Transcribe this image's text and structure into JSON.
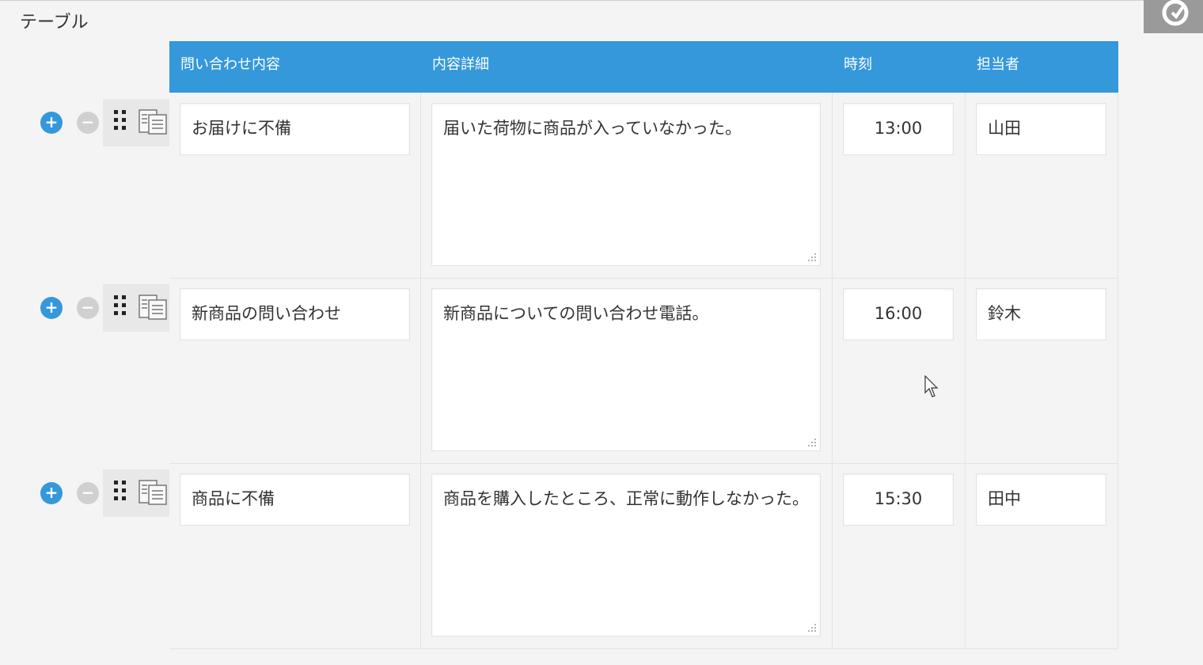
{
  "section": {
    "title": "テーブル"
  },
  "table": {
    "headers": [
      "問い合わせ内容",
      "内容詳細",
      "時刻",
      "担当者"
    ],
    "rows": [
      {
        "inquiry": "お届けに不備",
        "detail": "届いた荷物に商品が入っていなかった。",
        "time": "13:00",
        "owner": "山田"
      },
      {
        "inquiry": "新商品の問い合わせ",
        "detail": "新商品についての問い合わせ電話。",
        "time": "16:00",
        "owner": "鈴木"
      },
      {
        "inquiry": "商品に不備",
        "detail": "商品を購入したところ、正常に動作しなかった。",
        "time": "15:30",
        "owner": "田中"
      }
    ]
  },
  "controls": {
    "add_symbol": "+",
    "remove_symbol": "−"
  },
  "icons": {
    "add": "plus-circle-icon",
    "remove": "minus-circle-icon",
    "drag": "drag-handle-icon",
    "copy": "copy-icon",
    "refresh": "refresh-icon",
    "resize": "resize-grip-icon"
  },
  "colors": {
    "accent": "#3498db",
    "header_text": "#ffffff",
    "disabled": "#d0d0d0"
  }
}
